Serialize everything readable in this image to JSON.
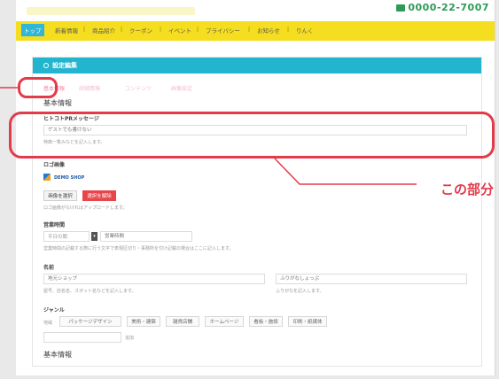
{
  "header": {
    "phone": "0000-22-7007"
  },
  "nav": {
    "items": [
      "トップ",
      "新着情報",
      "商品紹介",
      "クーポン",
      "イベント",
      "プライバシー",
      "お知らせ",
      "りんく"
    ]
  },
  "panel": {
    "title": "設定編集",
    "tabs": [
      "基本情報",
      "詳細情報",
      "コンテンツ",
      "画像設定"
    ],
    "section_title": "基本情報",
    "message": {
      "label": "ヒトコトPRメッセージ",
      "placeholder": "ゲストでも書けない",
      "hint": "特典一覧みなどを記入します。"
    },
    "logo": {
      "label": "ロゴ画像",
      "thumb_text": "DEMO SHOP",
      "select_button": "画像を選択",
      "delete_button": "選択を解除",
      "hint": "ロゴ画像がなければアップロードします。"
    },
    "hours": {
      "label": "営業時間",
      "select_value": "平日の朝",
      "input_placeholder": "営業時間",
      "hint": "営業時間の記載する際に行う文字で表現区切り・事務所を付け記載の場合はここに記入します。"
    },
    "name": {
      "label": "名前",
      "field1_placeholder": "地元ショップ",
      "field2_placeholder": "ふりがなしょっぷ",
      "hint1": "屋号、店名名、スポット名などを記入します。",
      "hint2": "ふりがなを記入します。"
    },
    "genre": {
      "label": "ジャンル",
      "row_label": "地域",
      "chips": [
        "パッケージデザイン",
        "美術・建築",
        "雑貨店舗",
        "ホームページ",
        "看板・施設",
        "印刷・紙媒体"
      ],
      "add_label": "追加"
    },
    "footer_section_title": "基本情報"
  },
  "annotation": {
    "callout": "この部分",
    "color": "#e23b4a"
  }
}
